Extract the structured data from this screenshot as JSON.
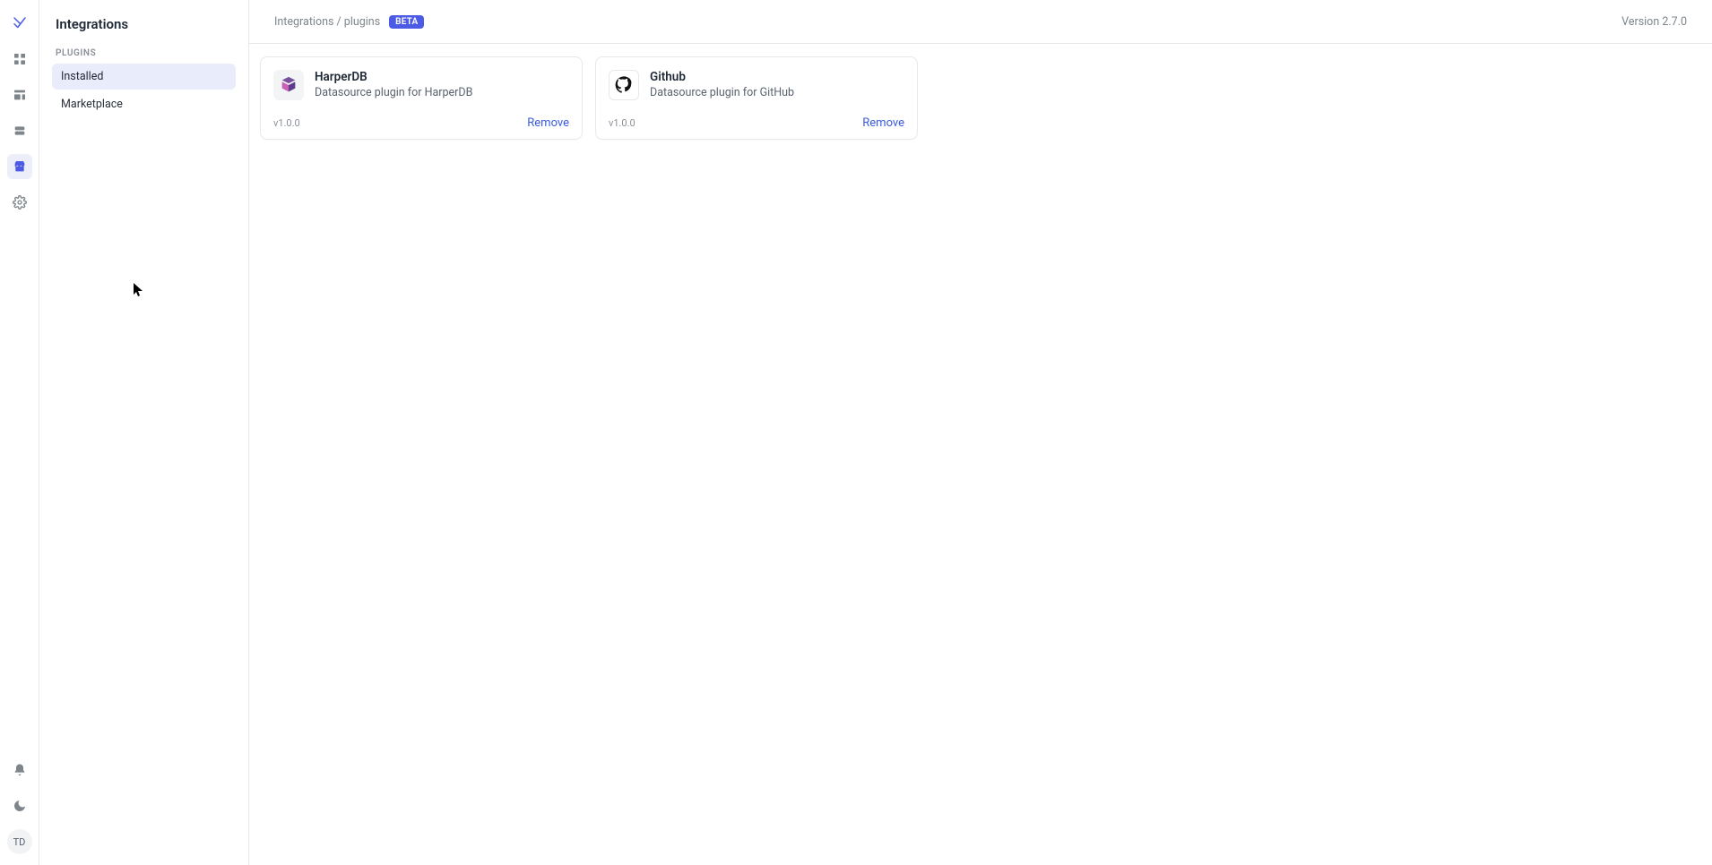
{
  "rail": {
    "avatar_initials": "TD"
  },
  "sidebar": {
    "title": "Integrations",
    "section_label": "PLUGINS",
    "items": [
      {
        "label": "Installed"
      },
      {
        "label": "Marketplace"
      }
    ]
  },
  "topbar": {
    "breadcrumb": "Integrations / plugins",
    "badge": "BETA",
    "version": "Version 2.7.0"
  },
  "plugins": [
    {
      "name": "HarperDB",
      "description": "Datasource plugin for HarperDB",
      "version": "v1.0.0",
      "remove_label": "Remove",
      "icon": "harperdb"
    },
    {
      "name": "Github",
      "description": "Datasource plugin for GitHub",
      "version": "v1.0.0",
      "remove_label": "Remove",
      "icon": "github"
    }
  ]
}
